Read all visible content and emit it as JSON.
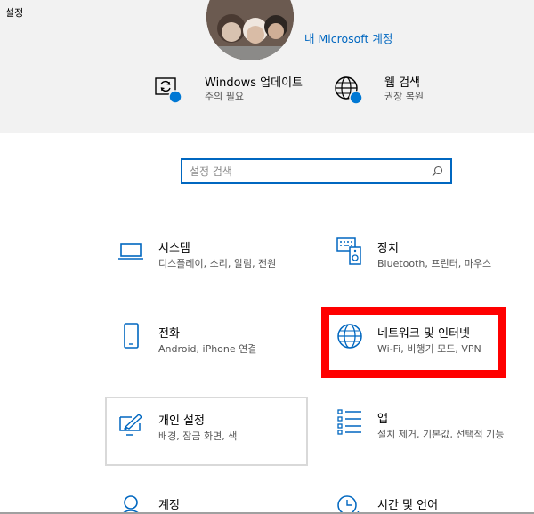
{
  "window": {
    "title": "설정"
  },
  "header": {
    "account_link": "내 Microsoft 계정",
    "quick_items": [
      {
        "title": "Windows 업데이트",
        "subtitle": "주의 필요",
        "icon": "update-icon"
      },
      {
        "title": "웹 검색",
        "subtitle": "권장 복원",
        "icon": "globe-icon"
      }
    ]
  },
  "search": {
    "placeholder": "설정 검색",
    "value": ""
  },
  "tiles": [
    {
      "title": "시스템",
      "subtitle": "디스플레이, 소리, 알림, 전원",
      "icon": "laptop-icon"
    },
    {
      "title": "장치",
      "subtitle": "Bluetooth, 프린터, 마우스",
      "icon": "devices-icon"
    },
    {
      "title": "전화",
      "subtitle": "Android, iPhone 연결",
      "icon": "phone-icon"
    },
    {
      "title": "네트워크 및 인터넷",
      "subtitle": "Wi-Fi, 비행기 모드, VPN",
      "icon": "globe-icon"
    },
    {
      "title": "개인 설정",
      "subtitle": "배경, 잠금 화면, 색",
      "icon": "personalization-icon"
    },
    {
      "title": "앱",
      "subtitle": "설치 제거, 기본값, 선택적 기능",
      "icon": "apps-list-icon"
    },
    {
      "title": "계정",
      "subtitle": "",
      "icon": "person-icon"
    },
    {
      "title": "시간 및 언어",
      "subtitle": "",
      "icon": "time-language-icon"
    }
  ],
  "colors": {
    "accent": "#0067c0",
    "header_bg": "#f2f2f2",
    "badge": "#0078d4",
    "highlight": "#ff0000"
  }
}
